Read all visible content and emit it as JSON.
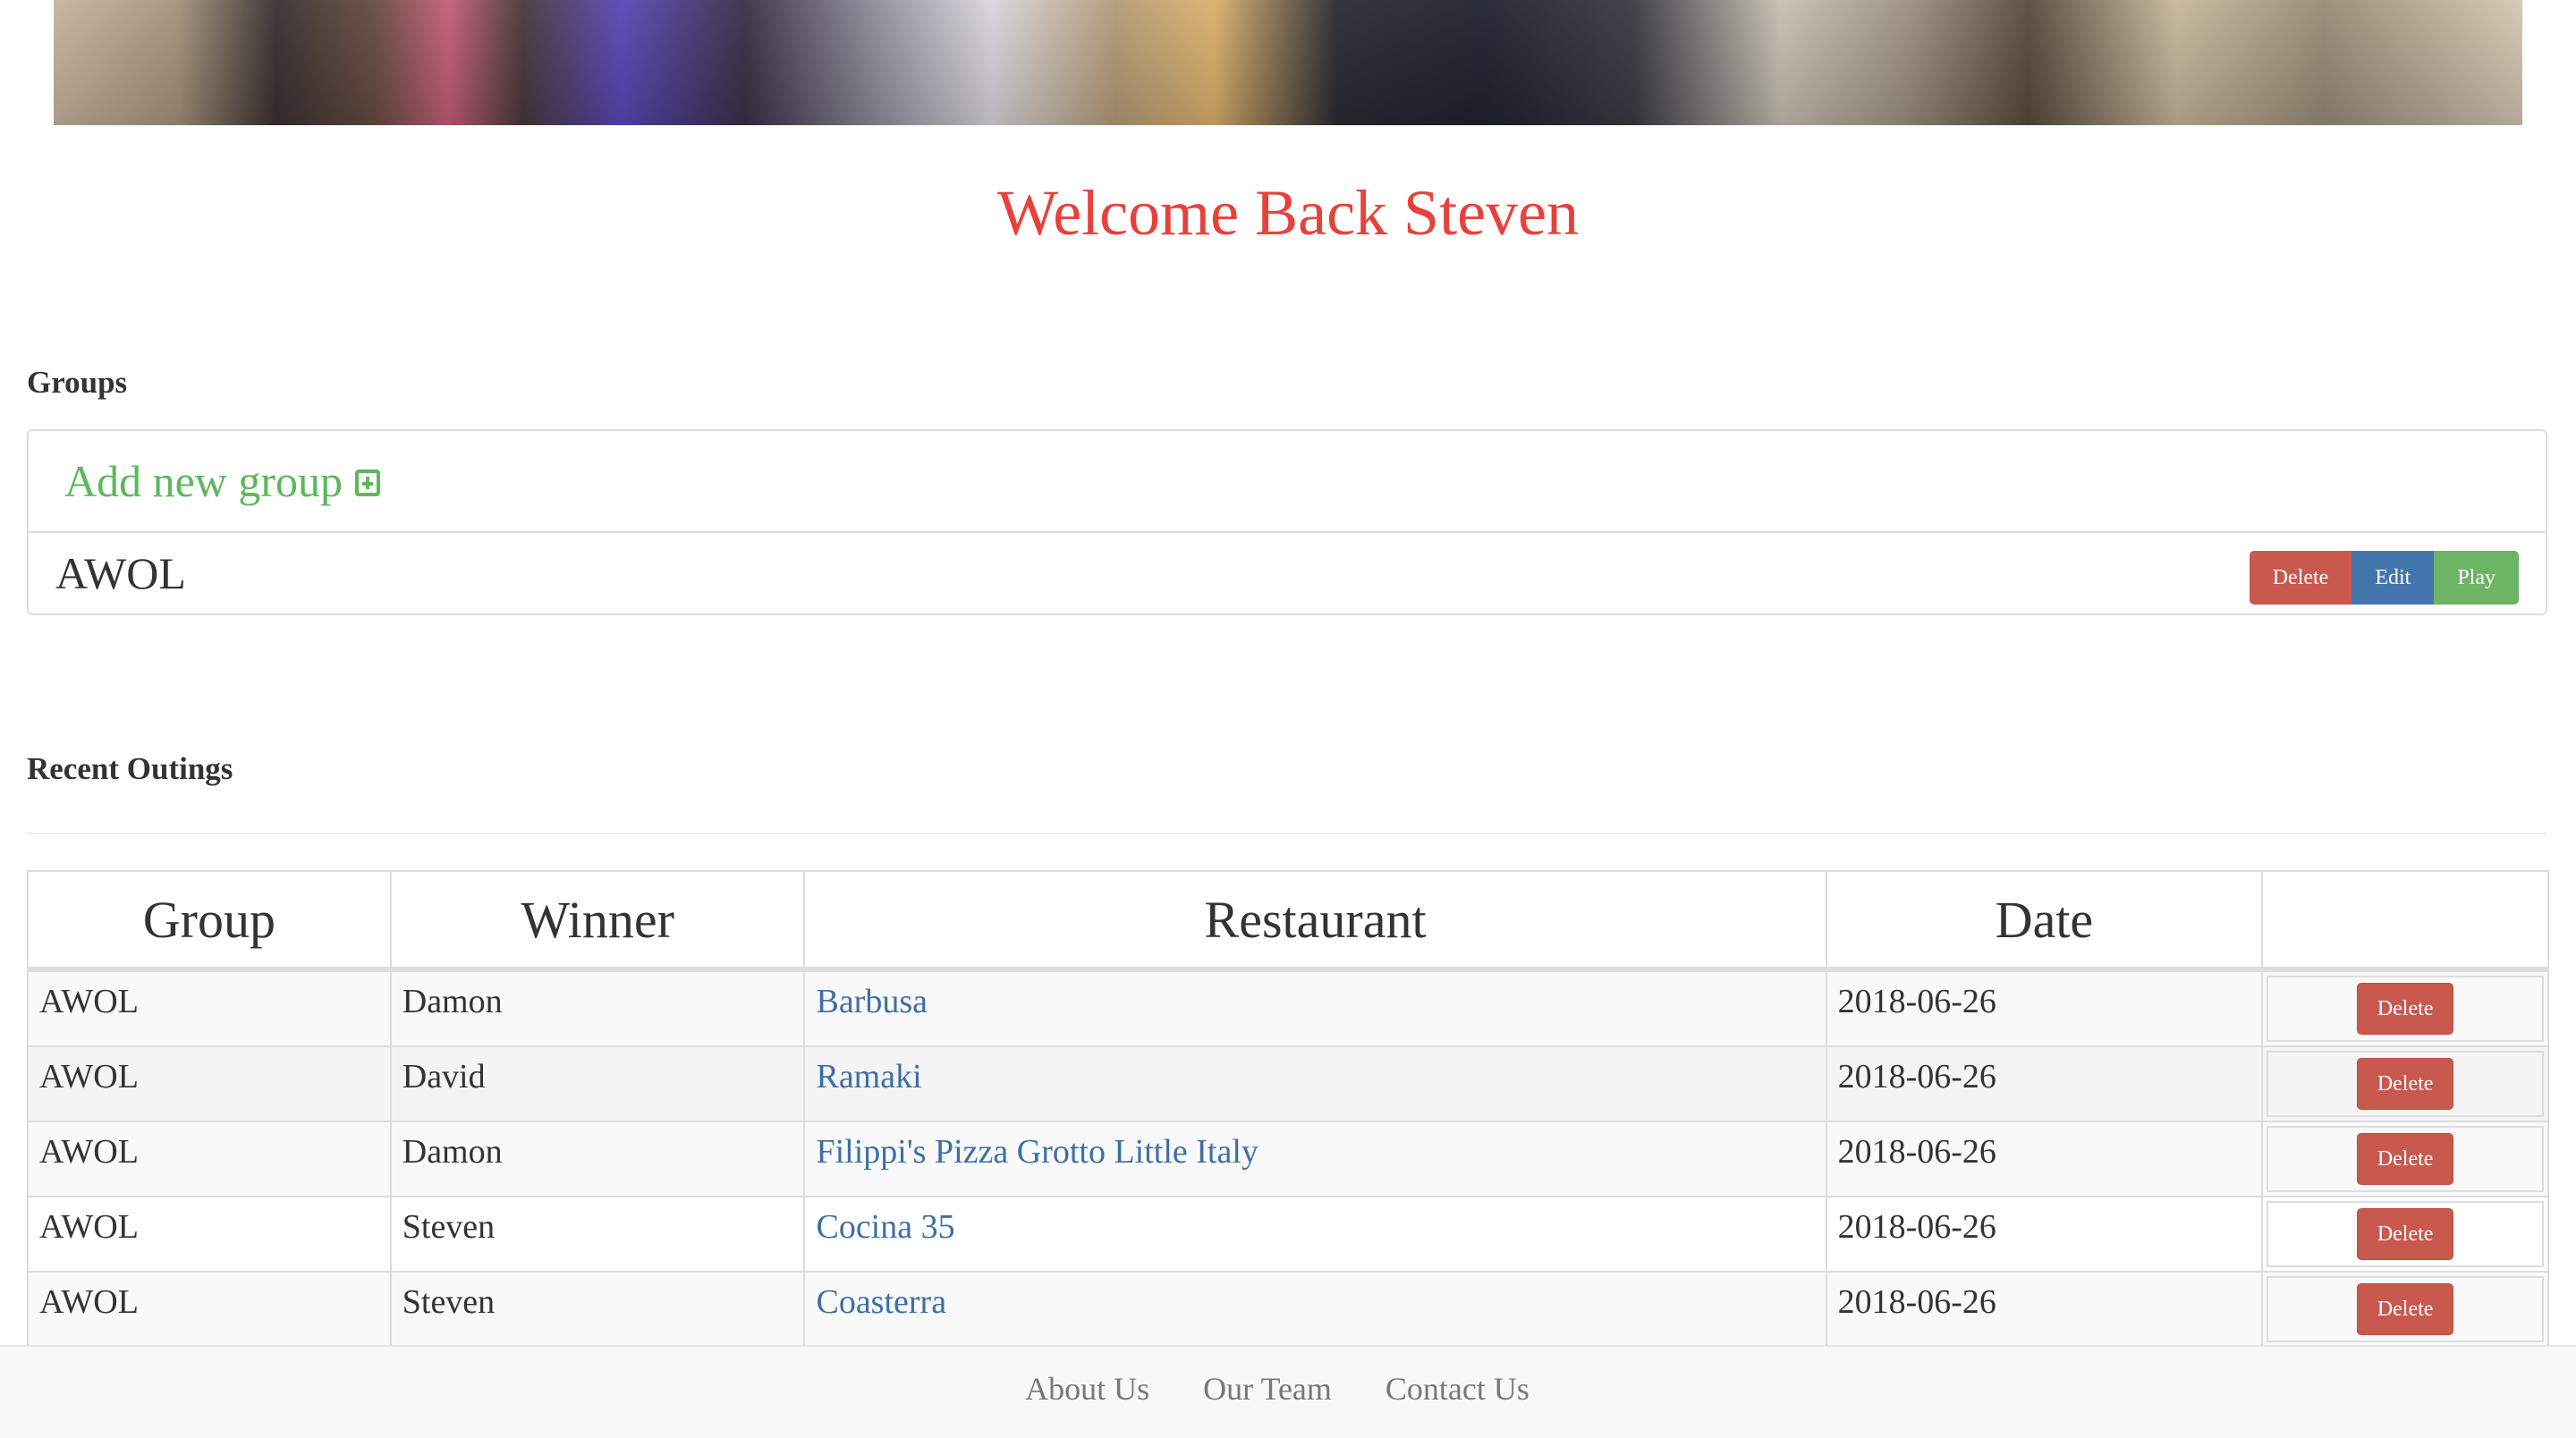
{
  "banner": {
    "image": "restaurant-diners-photo"
  },
  "welcome": {
    "text": "Welcome Back Steven",
    "color": "#e8413b"
  },
  "groups": {
    "title": "Groups",
    "add_label": "Add new group",
    "add_icon": "plus-square-icon",
    "items": [
      {
        "name": "AWOL",
        "actions": {
          "delete": "Delete",
          "edit": "Edit",
          "play": "Play"
        }
      }
    ]
  },
  "recent_outings": {
    "title": "Recent Outings",
    "columns": [
      "Group",
      "Winner",
      "Restaurant",
      "Date",
      ""
    ],
    "rows": [
      {
        "group": "AWOL",
        "winner": "Damon",
        "restaurant": "Barbusa",
        "date": "2018-06-26",
        "action": "Delete"
      },
      {
        "group": "AWOL",
        "winner": "David",
        "restaurant": "Ramaki",
        "date": "2018-06-26",
        "action": "Delete"
      },
      {
        "group": "AWOL",
        "winner": "Damon",
        "restaurant": "Filippi's Pizza Grotto Little Italy",
        "date": "2018-06-26",
        "action": "Delete"
      },
      {
        "group": "AWOL",
        "winner": "Steven",
        "restaurant": "Cocina 35",
        "date": "2018-06-26",
        "action": "Delete"
      },
      {
        "group": "AWOL",
        "winner": "Steven",
        "restaurant": "Coasterra",
        "date": "2018-06-26",
        "action": "Delete"
      }
    ]
  },
  "footer": {
    "links": [
      "About Us",
      "Our Team",
      "Contact Us"
    ]
  },
  "colors": {
    "danger": "#c9584f",
    "primary": "#4476ae",
    "success": "#6db464",
    "link": "#3d6fa6",
    "add_green": "#5cb85c"
  }
}
